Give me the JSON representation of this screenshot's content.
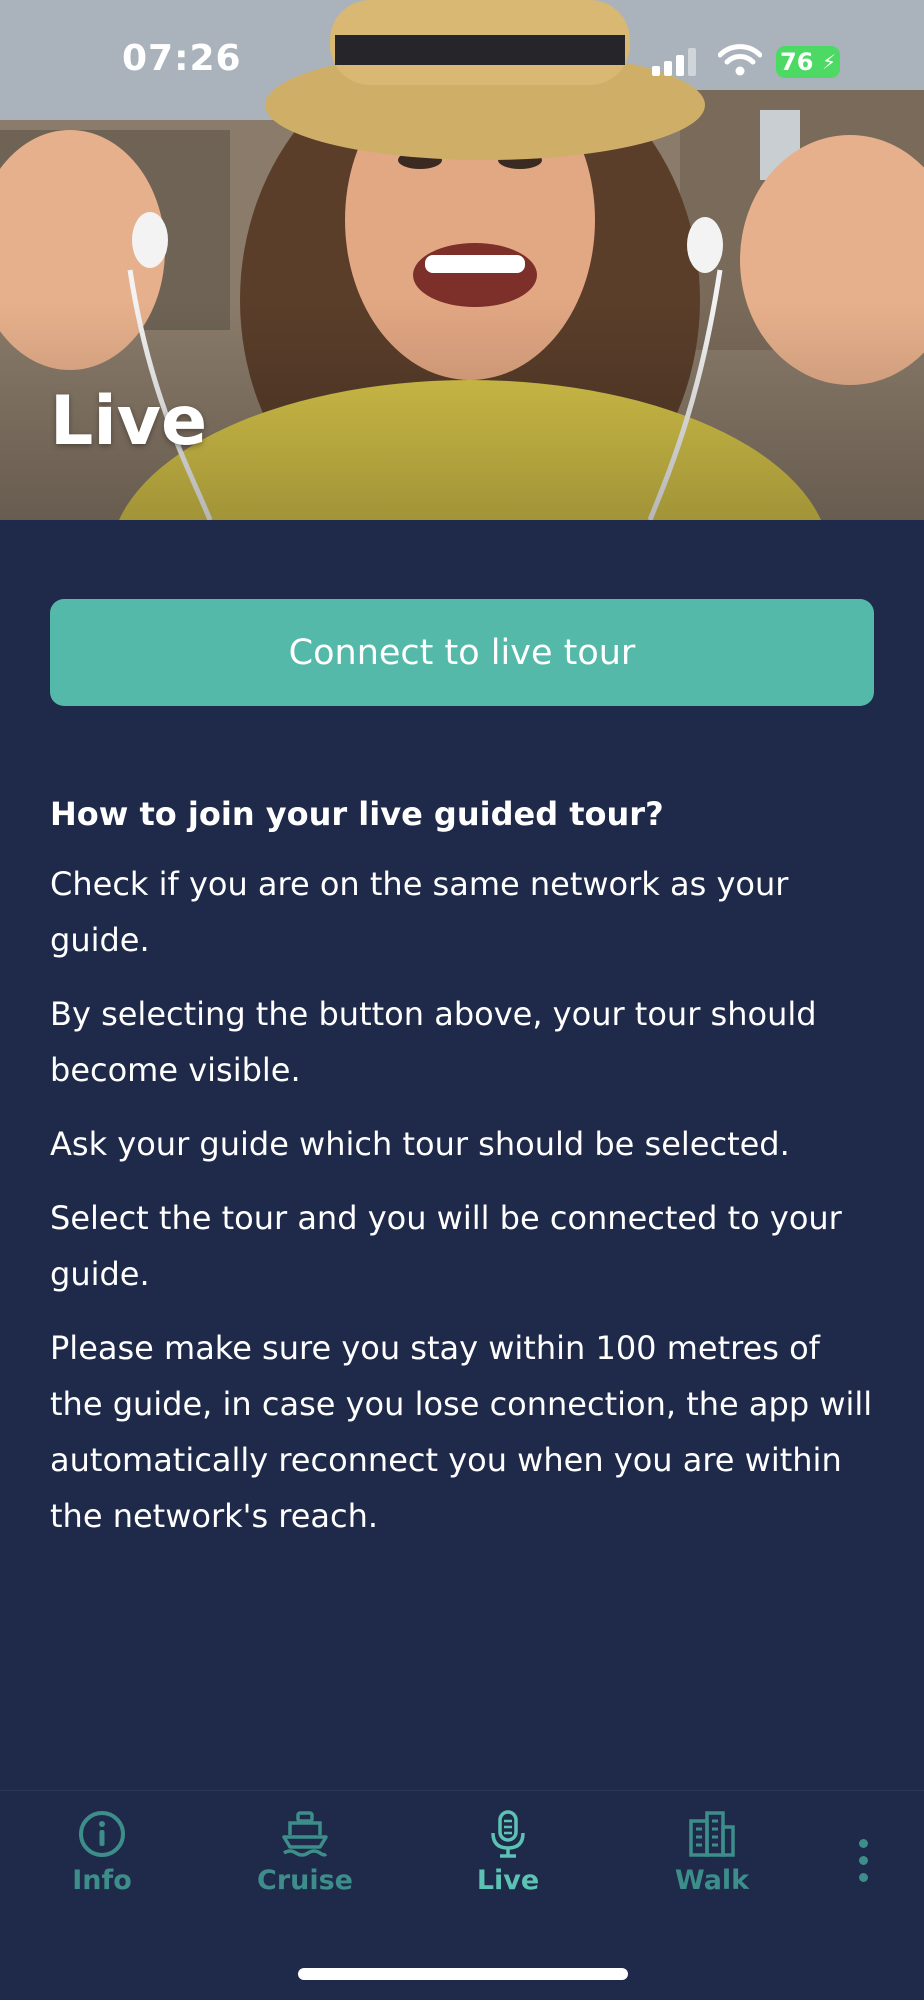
{
  "status_bar": {
    "time": "07:26",
    "battery": "76"
  },
  "hero": {
    "title": "Live"
  },
  "connect_button": {
    "label": "Connect to live tour"
  },
  "info": {
    "heading": "How to join your live guided tour?",
    "paragraphs": [
      "Check if you are on the same network as your guide.",
      "By selecting the button above, your tour should become visible.",
      "Ask your guide which tour should be selected.",
      "Select the tour and you will be connected to your guide.",
      "Please make sure you stay within 100 metres of the guide, in case you lose connection, the app will automatically reconnect you when you are within the network's reach."
    ]
  },
  "tab_bar": {
    "tabs": [
      {
        "label": "Info",
        "icon": "info-icon",
        "active": false
      },
      {
        "label": "Cruise",
        "icon": "ship-icon",
        "active": false
      },
      {
        "label": "Live",
        "icon": "microphone-icon",
        "active": true
      },
      {
        "label": "Walk",
        "icon": "buildings-icon",
        "active": false
      }
    ],
    "more_icon": "more-vertical-icon"
  },
  "colors": {
    "background": "#1f2a4a",
    "accent": "#55b9a9",
    "tab_inactive": "#3d8d8a",
    "tab_active": "#5cc3b4"
  }
}
